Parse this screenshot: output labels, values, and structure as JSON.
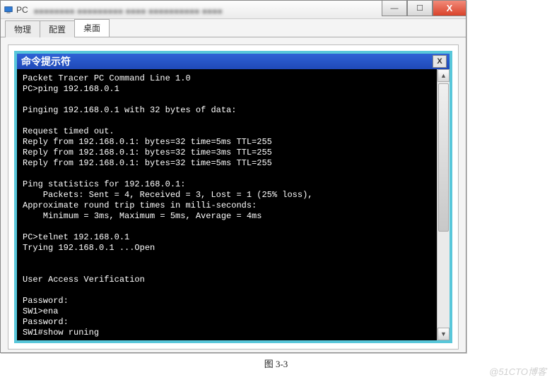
{
  "window": {
    "title": "PC",
    "controls": {
      "min": "—",
      "max": "☐",
      "close": "X"
    }
  },
  "tabs": [
    {
      "label": "物理",
      "active": false
    },
    {
      "label": "配置",
      "active": false
    },
    {
      "label": "桌面",
      "active": true
    }
  ],
  "cmd": {
    "title": "命令提示符",
    "close": "X"
  },
  "terminal_lines": [
    "Packet Tracer PC Command Line 1.0",
    "PC>ping 192.168.0.1",
    "",
    "Pinging 192.168.0.1 with 32 bytes of data:",
    "",
    "Request timed out.",
    "Reply from 192.168.0.1: bytes=32 time=5ms TTL=255",
    "Reply from 192.168.0.1: bytes=32 time=3ms TTL=255",
    "Reply from 192.168.0.1: bytes=32 time=5ms TTL=255",
    "",
    "Ping statistics for 192.168.0.1:",
    "    Packets: Sent = 4, Received = 3, Lost = 1 (25% loss),",
    "Approximate round trip times in milli-seconds:",
    "    Minimum = 3ms, Maximum = 5ms, Average = 4ms",
    "",
    "PC>telnet 192.168.0.1",
    "Trying 192.168.0.1 ...Open",
    "",
    "",
    "User Access Verification",
    "",
    "Password:",
    "SW1>ena",
    "Password:",
    "SW1#show runing"
  ],
  "caption": "图 3-3",
  "watermark": "@51CTO博客"
}
